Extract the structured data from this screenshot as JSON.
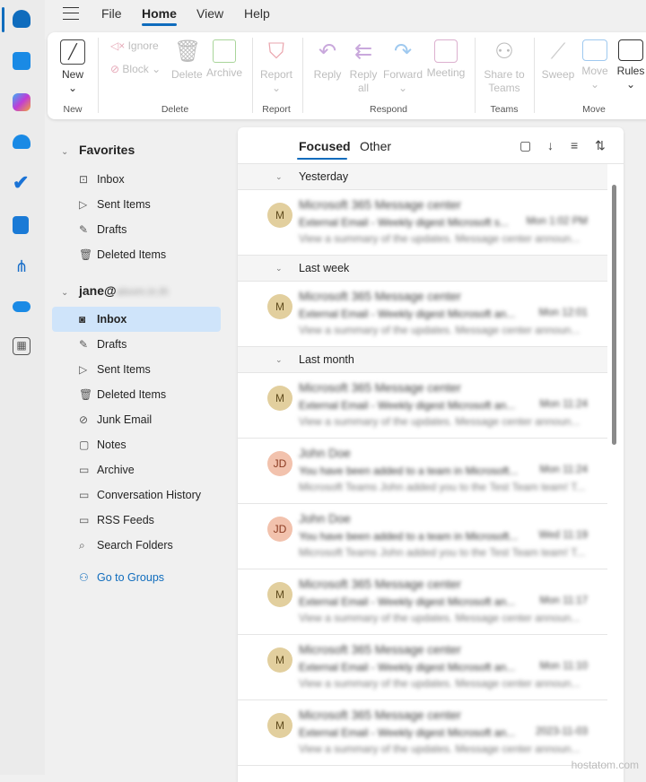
{
  "app_rail": {
    "items": [
      "mail-icon",
      "calendar-icon",
      "copilot-icon",
      "people-icon",
      "todo-icon",
      "onenote-icon",
      "org-explorer-icon",
      "onedrive-icon",
      "more-apps-icon"
    ]
  },
  "menu": {
    "tabs": [
      "File",
      "Home",
      "View",
      "Help"
    ],
    "selected": "Home"
  },
  "ribbon": {
    "new_label": "New",
    "ignore_label": "Ignore",
    "block_label": "Block",
    "delete_label": "Delete",
    "archive_label": "Archive",
    "report_label": "Report",
    "reply_label": "Reply",
    "reply_all_label": "Reply all",
    "forward_label": "Forward",
    "meeting_label": "Meeting",
    "share_teams_label": "Share to Teams",
    "sweep_label": "Sweep",
    "move_label": "Move",
    "rules_label": "Rules",
    "groups": {
      "new": "New",
      "delete": "Delete",
      "report": "Report",
      "respond": "Respond",
      "teams": "Teams",
      "move": "Move"
    }
  },
  "folders": {
    "favorites_label": "Favorites",
    "favorites": [
      {
        "label": "Inbox",
        "icon": "inbox-icon"
      },
      {
        "label": "Sent Items",
        "icon": "send-icon"
      },
      {
        "label": "Drafts",
        "icon": "drafts-icon"
      },
      {
        "label": "Deleted Items",
        "icon": "trash-icon"
      }
    ],
    "account_label": "jane@",
    "account_blurred": "alsom.in.th",
    "account_folders": [
      {
        "label": "Inbox",
        "icon": "inbox-icon"
      },
      {
        "label": "Drafts",
        "icon": "drafts-icon"
      },
      {
        "label": "Sent Items",
        "icon": "send-icon"
      },
      {
        "label": "Deleted Items",
        "icon": "trash-icon"
      },
      {
        "label": "Junk Email",
        "icon": "junk-icon"
      },
      {
        "label": "Notes",
        "icon": "note-icon"
      },
      {
        "label": "Archive",
        "icon": "archive-icon"
      },
      {
        "label": "Conversation History",
        "icon": "folder-icon"
      },
      {
        "label": "RSS Feeds",
        "icon": "folder-icon"
      },
      {
        "label": "Search Folders",
        "icon": "search-folder-icon"
      }
    ],
    "groups_link": "Go to Groups"
  },
  "list": {
    "tabs": [
      "Focused",
      "Other"
    ],
    "groups": [
      {
        "label": "Yesterday",
        "messages": [
          {
            "avatar": "M",
            "sender": "Microsoft 365 Message center",
            "subject": "External Email - Weekly digest Microsoft s...",
            "time": "Mon 1:02 PM",
            "preview": "View a summary of the updates. Message center announ..."
          }
        ]
      },
      {
        "label": "Last week",
        "messages": [
          {
            "avatar": "M",
            "sender": "Microsoft 365 Message center",
            "subject": "External Email - Weekly digest Microsoft an...",
            "time": "Mon 12:01",
            "preview": "View a summary of the updates. Message center announ..."
          }
        ]
      },
      {
        "label": "Last month",
        "messages": [
          {
            "avatar": "M",
            "sender": "Microsoft 365 Message center",
            "subject": "External Email - Weekly digest Microsoft an...",
            "time": "Mon 11:24",
            "preview": "View a summary of the updates. Message center announ..."
          },
          {
            "avatar": "JD",
            "sender": "John Doe",
            "subject": "You have been added to a team in Microsoft...",
            "time": "Mon 11:24",
            "preview": "Microsoft Teams John added you to the Test Team team! T..."
          },
          {
            "avatar": "JD",
            "sender": "John Doe",
            "subject": "You have been added to a team in Microsoft...",
            "time": "Wed 11:19",
            "preview": "Microsoft Teams John added you to the Test Team team! T..."
          },
          {
            "avatar": "M",
            "sender": "Microsoft 365 Message center",
            "subject": "External Email - Weekly digest Microsoft an...",
            "time": "Mon 11:17",
            "preview": "View a summary of the updates. Message center announ..."
          },
          {
            "avatar": "M",
            "sender": "Microsoft 365 Message center",
            "subject": "External Email - Weekly digest Microsoft an...",
            "time": "Mon 11:10",
            "preview": "View a summary of the updates. Message center announ..."
          },
          {
            "avatar": "M",
            "sender": "Microsoft 365 Message center",
            "subject": "External Email - Weekly digest Microsoft an...",
            "time": "2023-11-03",
            "preview": "View a summary of the updates. Message center announ..."
          }
        ]
      }
    ]
  },
  "colors": {
    "accent": "#0f6cbd",
    "avatar_m": "#e2cf9e",
    "avatar_jd": "#f2c2ad",
    "selected_folder": "#cfe4fa"
  },
  "watermark": "hostatom.com"
}
